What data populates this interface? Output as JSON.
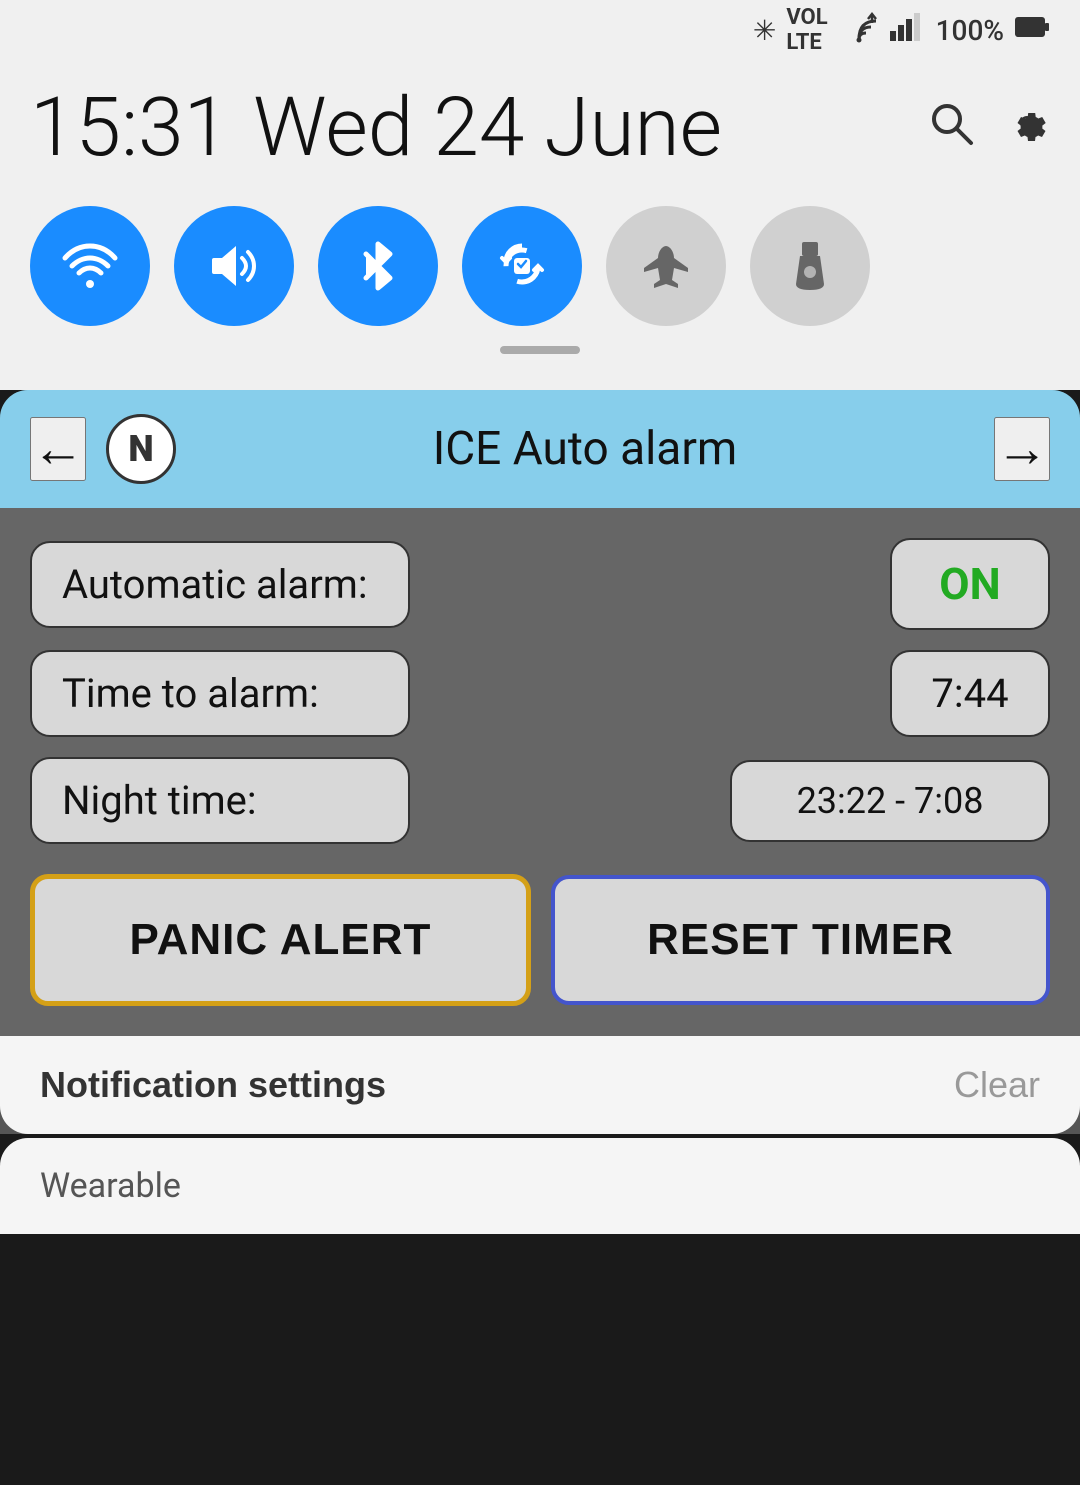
{
  "statusBar": {
    "time": "15:31",
    "date": "Wed 24 June",
    "batteryPercent": "100%",
    "icons": {
      "bluetooth": "✳",
      "lte": "LTE",
      "wifi": "📶",
      "signal": "📶",
      "battery": "🔋"
    }
  },
  "quickToggles": {
    "wifi": {
      "label": "WiFi",
      "active": true
    },
    "sound": {
      "label": "Sound",
      "active": true
    },
    "bluetooth": {
      "label": "Bluetooth",
      "active": true
    },
    "autoRotate": {
      "label": "Auto Rotate",
      "active": true
    },
    "airplane": {
      "label": "Airplane Mode",
      "active": false
    },
    "flashlight": {
      "label": "Flashlight",
      "active": false
    }
  },
  "searchIcon": "search",
  "settingsIcon": "settings",
  "notification": {
    "appName": "ICE Auto alarm",
    "appIconLetter": "N",
    "backArrow": "←",
    "forwardArrow": "→",
    "rows": [
      {
        "label": "Automatic alarm:",
        "value": "ON",
        "valueType": "on"
      },
      {
        "label": "Time to alarm:",
        "value": "7:44",
        "valueType": "normal"
      },
      {
        "label": "Night time:",
        "value": "23:22 - 7:08",
        "valueType": "range"
      }
    ],
    "panicButton": "PANIC ALERT",
    "resetButton": "RESET TIMER"
  },
  "bottomBar": {
    "notificationSettings": "Notification settings",
    "clear": "Clear"
  },
  "wearableSection": {
    "label": "Wearable"
  }
}
